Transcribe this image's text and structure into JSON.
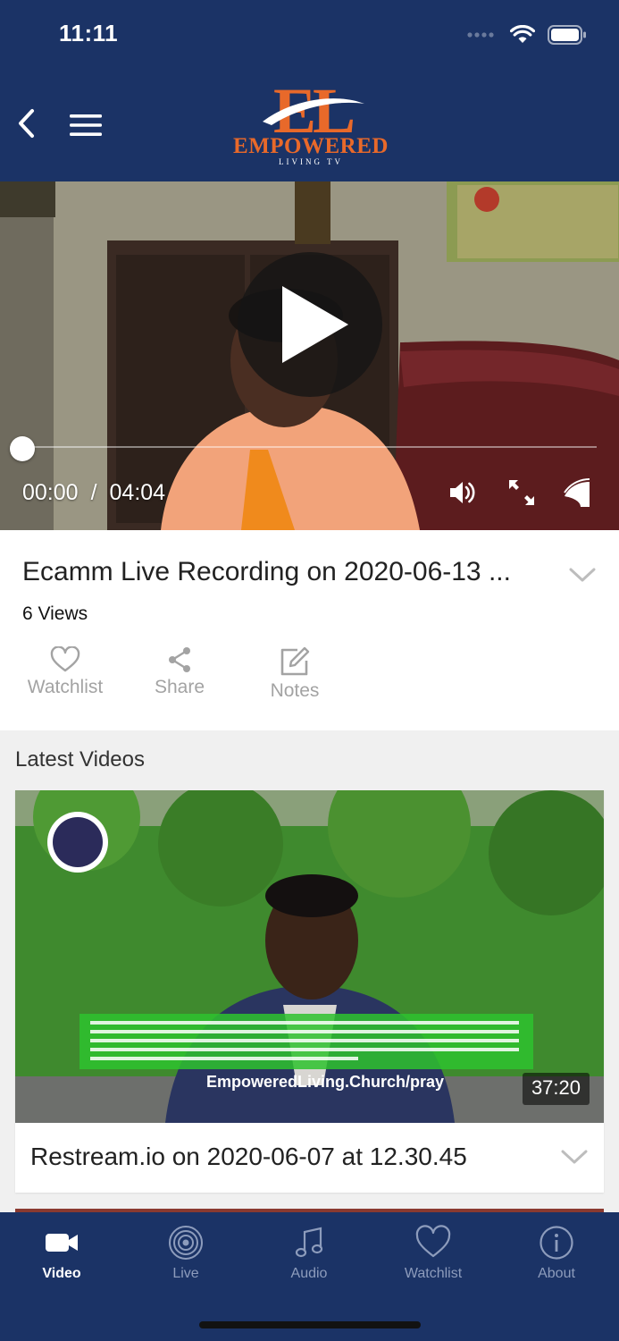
{
  "status_bar": {
    "time": "11:11"
  },
  "header": {
    "logo_mark": "EL",
    "logo_name": "EMPOWERED",
    "logo_sub": "LIVING TV"
  },
  "player": {
    "current_time": "00:00",
    "separator": "/",
    "total_time": "04:04",
    "progress": 0
  },
  "video": {
    "title": "Ecamm Live Recording on 2020-06-13 ...",
    "views": "6 Views",
    "actions": [
      {
        "label": "Watchlist",
        "icon": "heart-icon"
      },
      {
        "label": "Share",
        "icon": "share-icon"
      },
      {
        "label": "Notes",
        "icon": "edit-icon"
      }
    ]
  },
  "latest": {
    "heading": "Latest Videos",
    "items": [
      {
        "title": "Restream.io on 2020-06-07 at 12.30.45",
        "duration": "37:20",
        "overlay_caption": "EmpoweredLiving.Church/pray"
      }
    ]
  },
  "tabbar": {
    "tabs": [
      {
        "label": "Video",
        "icon": "video-camera-icon",
        "active": true
      },
      {
        "label": "Live",
        "icon": "broadcast-icon",
        "active": false
      },
      {
        "label": "Audio",
        "icon": "music-note-icon",
        "active": false
      },
      {
        "label": "Watchlist",
        "icon": "heart-icon",
        "active": false
      },
      {
        "label": "About",
        "icon": "info-icon",
        "active": false
      }
    ]
  },
  "colors": {
    "brand_navy": "#1b3366",
    "brand_orange": "#e8692a",
    "tab_inactive": "#8d9cbc",
    "action_gray": "#a3a3a3"
  }
}
